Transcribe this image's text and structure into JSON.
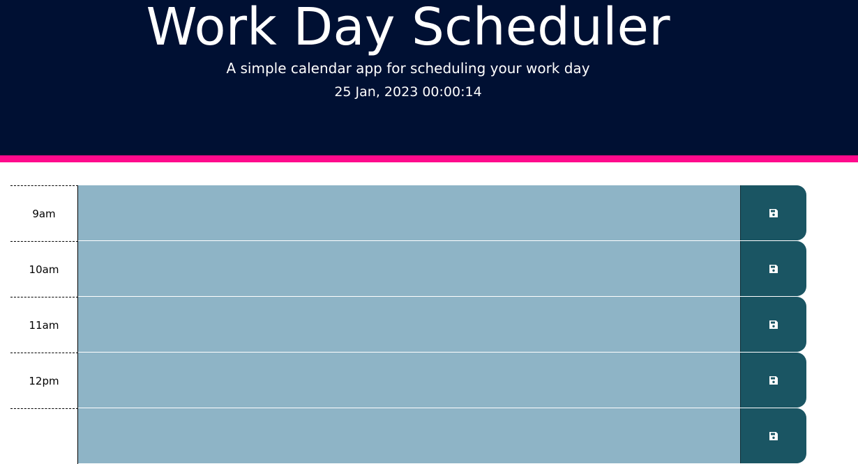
{
  "header": {
    "title": "Work Day Scheduler",
    "subtitle": "A simple calendar app for scheduling your work day",
    "current_day": "25 Jan, 2023 00:00:14"
  },
  "colors": {
    "header_bg": "#001033",
    "accent_bar": "#ff0a8c",
    "past_block": "#8eb4c6",
    "save_button": "#1a5563"
  },
  "time_blocks": [
    {
      "hour": "9am",
      "description": "",
      "save_icon": "floppy-disk-icon"
    },
    {
      "hour": "10am",
      "description": "",
      "save_icon": "floppy-disk-icon"
    },
    {
      "hour": "11am",
      "description": "",
      "save_icon": "floppy-disk-icon"
    },
    {
      "hour": "12pm",
      "description": "",
      "save_icon": "floppy-disk-icon"
    },
    {
      "hour": "",
      "description": "",
      "save_icon": "floppy-disk-icon"
    }
  ]
}
